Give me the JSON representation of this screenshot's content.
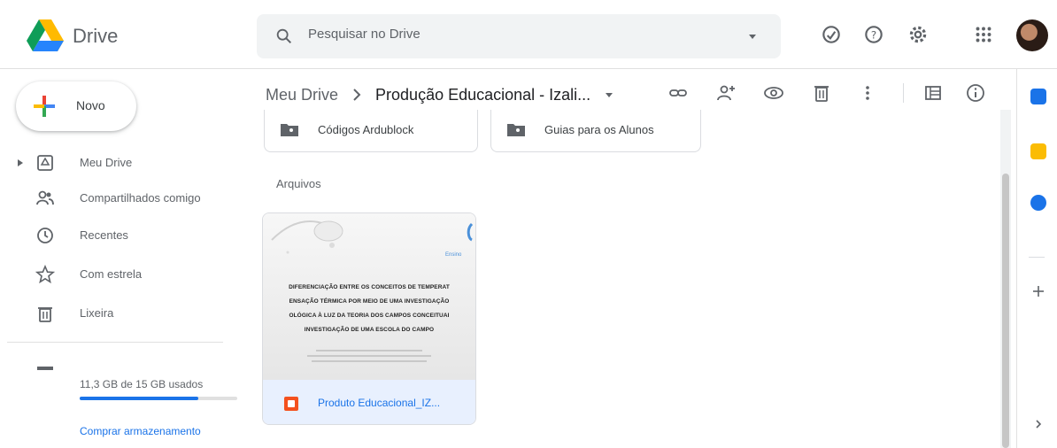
{
  "app": {
    "name": "Drive"
  },
  "search": {
    "placeholder": "Pesquisar no Drive"
  },
  "header_icons": [
    "offline-icon",
    "help-icon",
    "settings-icon",
    "apps-grid-icon",
    "avatar"
  ],
  "sidebar": {
    "new_label": "Novo",
    "items": [
      {
        "label": "Meu Drive",
        "icon": "my-drive-icon"
      },
      {
        "label": "Compartilhados comigo",
        "icon": "shared-icon"
      },
      {
        "label": "Recentes",
        "icon": "clock-icon"
      },
      {
        "label": "Com estrela",
        "icon": "star-icon"
      },
      {
        "label": "Lixeira",
        "icon": "trash-icon"
      }
    ],
    "storage": {
      "text": "11,3 GB de 15 GB usados",
      "used_fraction": 0.75,
      "buy_label": "Comprar armazenamento"
    }
  },
  "breadcrumb": {
    "root": "Meu Drive",
    "current": "Produção Educacional - Izali..."
  },
  "toolbar_icons": [
    "link-icon",
    "add-person-icon",
    "preview-icon",
    "delete-icon",
    "more-icon",
    "view-toggle-icon",
    "info-icon"
  ],
  "folders": [
    {
      "name": "Códigos Ardublock"
    },
    {
      "name": "Guias para os Alunos"
    }
  ],
  "files_section_label": "Arquivos",
  "file": {
    "name": "Produto Educacional_IZ...",
    "thumbnail_lines": [
      "DIFERENCIAÇÃO ENTRE OS CONCEITOS DE TEMPERAT",
      "ENSAÇÃO TÉRMICA POR MEIO DE UMA INVESTIGAÇÃO",
      "OLÓGICA À LUZ DA TEORIA DOS CAMPOS CONCEITUAI",
      "INVESTIGAÇÃO DE UMA ESCOLA DO CAMPO"
    ],
    "thumbnail_brand": "Ensino"
  },
  "colors": {
    "accent": "#1a73e8",
    "selected_bg": "#e8f0fe",
    "slides_orange": "#f4511e"
  }
}
